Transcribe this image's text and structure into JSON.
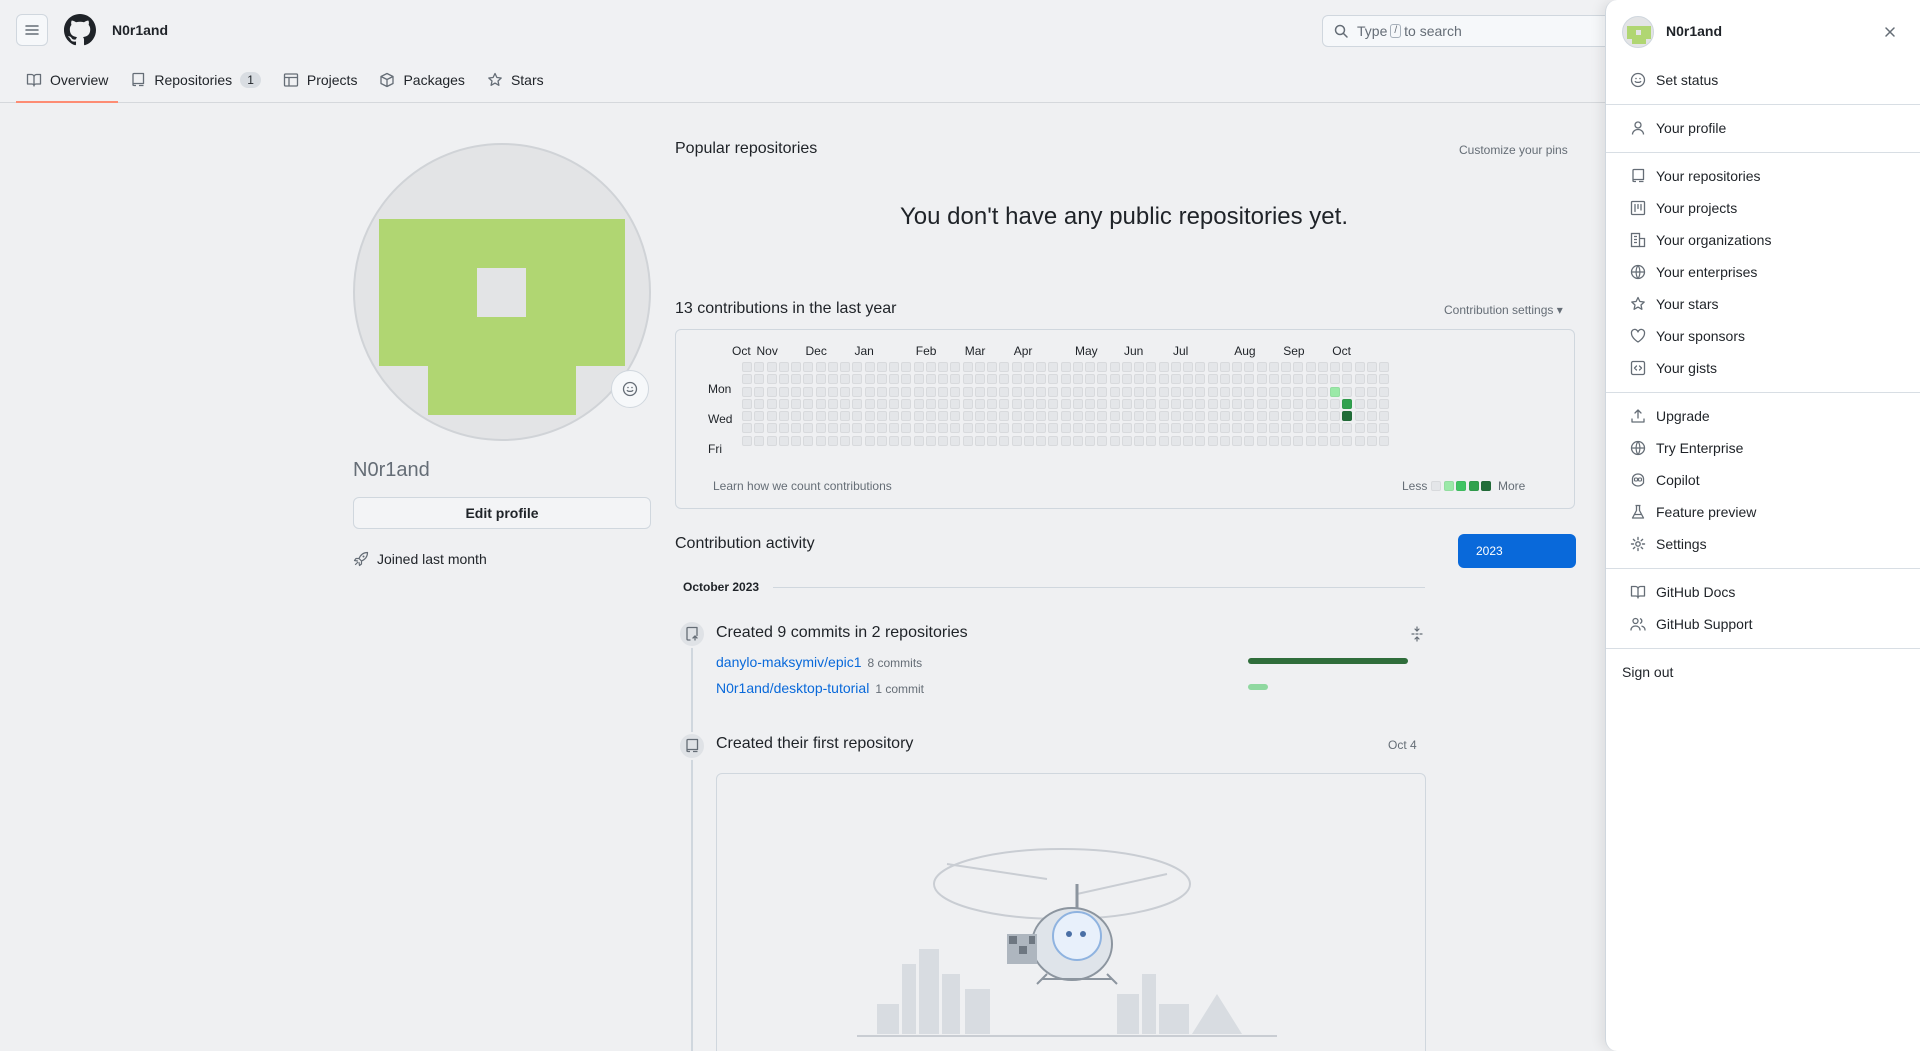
{
  "header": {
    "owner_name": "N0r1and",
    "search_placeholder_pre": "Type",
    "search_key": "/",
    "search_placeholder_post": "to search",
    "tabs": [
      {
        "label": "Overview",
        "icon": "book-icon"
      },
      {
        "label": "Repositories",
        "icon": "repo-icon",
        "count": "1"
      },
      {
        "label": "Projects",
        "icon": "table-icon"
      },
      {
        "label": "Packages",
        "icon": "package-icon"
      },
      {
        "label": "Stars",
        "icon": "star-icon"
      }
    ]
  },
  "profile": {
    "login": "N0r1and",
    "edit_label": "Edit profile",
    "joined": "Joined last month",
    "avatar_color": "#b0d672"
  },
  "main": {
    "popular_title": "Popular repositories",
    "customize_pins": "Customize your pins",
    "empty_repos": "You don't have any public repositories yet.",
    "contrib_title": "13 contributions in the last year",
    "contrib_settings": "Contribution settings ▾",
    "months": [
      "Oct",
      "Nov",
      "Dec",
      "Jan",
      "Feb",
      "Mar",
      "Apr",
      "May",
      "Jun",
      "Jul",
      "Aug",
      "Sep",
      "Oct"
    ],
    "days": [
      "Mon",
      "Wed",
      "Fri"
    ],
    "learn_link": "Learn how we count contributions",
    "legend_less": "Less",
    "legend_more": "More",
    "level_colors": [
      "#e4e6e9",
      "#9be9a8",
      "#40c463",
      "#30a14e",
      "#216e39"
    ],
    "contributions": [
      {
        "week": 48,
        "day": 2,
        "level": 1
      },
      {
        "week": 49,
        "day": 3,
        "level": 3
      },
      {
        "week": 49,
        "day": 4,
        "level": 4
      }
    ],
    "activity_title": "Contribution activity",
    "year": "2023",
    "month_heading": "October 2023",
    "commits_title": "Created 9 commits in 2 repositories",
    "commit_repos": [
      {
        "name": "danylo-maksymiv/epic1",
        "commits": "8 commits",
        "fraction": 1.0,
        "color": "#2f6d3b"
      },
      {
        "name": "N0r1and/desktop-tutorial",
        "commits": "1 commit",
        "fraction": 0.125,
        "color": "#8fd8a0"
      }
    ],
    "first_repo_title": "Created their first repository",
    "first_repo_date": "Oct 4"
  },
  "menu": {
    "name": "N0r1and",
    "groups": [
      [
        {
          "label": "Set status",
          "icon": "smiley-icon"
        }
      ],
      [
        {
          "label": "Your profile",
          "icon": "person-icon"
        }
      ],
      [
        {
          "label": "Your repositories",
          "icon": "repo-icon"
        },
        {
          "label": "Your projects",
          "icon": "project-icon"
        },
        {
          "label": "Your organizations",
          "icon": "organization-icon"
        },
        {
          "label": "Your enterprises",
          "icon": "globe-icon"
        },
        {
          "label": "Your stars",
          "icon": "star-icon"
        },
        {
          "label": "Your sponsors",
          "icon": "heart-icon"
        },
        {
          "label": "Your gists",
          "icon": "code-square-icon"
        }
      ],
      [
        {
          "label": "Upgrade",
          "icon": "upload-icon"
        },
        {
          "label": "Try Enterprise",
          "icon": "globe-icon"
        },
        {
          "label": "Copilot",
          "icon": "copilot-icon"
        },
        {
          "label": "Feature preview",
          "icon": "beaker-icon"
        },
        {
          "label": "Settings",
          "icon": "gear-icon"
        }
      ],
      [
        {
          "label": "GitHub Docs",
          "icon": "book-icon"
        },
        {
          "label": "GitHub Support",
          "icon": "people-icon"
        }
      ]
    ],
    "sign_out": "Sign out"
  }
}
